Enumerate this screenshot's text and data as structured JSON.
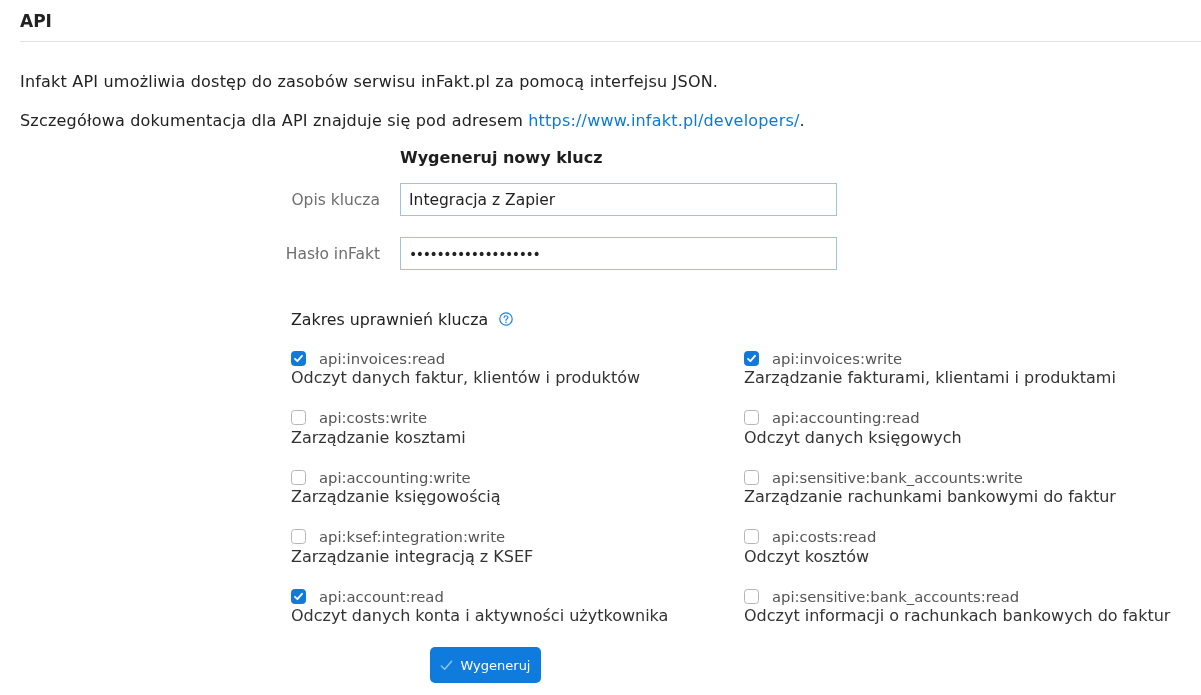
{
  "page": {
    "title": "API"
  },
  "intro": [
    {
      "text": "Infakt API umożliwia dostęp do zasobów serwisu inFakt.pl za pomocą interfejsu JSON."
    },
    {
      "text": "Szczegółowa dokumentacja dla API znajduje się pod adresem",
      "link": "https://www.infakt.pl/developers/",
      "suffix": "."
    }
  ],
  "form": {
    "title": "Wygeneruj nowy klucz",
    "fields": [
      {
        "label": "Opis klucza",
        "value": "Integracja z Zapier",
        "kind": "text"
      },
      {
        "label": "Hasło inFakt",
        "value": "•••••••••••••••••••",
        "kind": "password"
      }
    ]
  },
  "scopes": {
    "title": "Zakres uprawnień klucza",
    "items": [
      {
        "scope": "api:invoices:read",
        "description": "Odczyt danych faktur, klientów i produktów",
        "checked": true
      },
      {
        "scope": "api:invoices:write",
        "description": "Zarządzanie fakturami, klientami i produktami",
        "checked": true
      },
      {
        "scope": "api:costs:write",
        "description": "Zarządzanie kosztami",
        "checked": false
      },
      {
        "scope": "api:accounting:read",
        "description": "Odczyt danych księgowych",
        "checked": false
      },
      {
        "scope": "api:accounting:write",
        "description": "Zarządzanie księgowością",
        "checked": false
      },
      {
        "scope": "api:sensitive:bank_accounts:write",
        "description": "Zarządzanie rachunkami bankowymi do faktur",
        "checked": false
      },
      {
        "scope": "api:ksef:integration:write",
        "description": "Zarządzanie integracją z KSEF",
        "checked": false
      },
      {
        "scope": "api:costs:read",
        "description": "Odczyt kosztów",
        "checked": false
      },
      {
        "scope": "api:account:read",
        "description": "Odczyt danych konta i aktywności użytkownika",
        "checked": true
      },
      {
        "scope": "api:sensitive:bank_accounts:read",
        "description": "Odczyt informacji o rachunkach bankowych do faktur",
        "checked": false
      }
    ]
  },
  "submit": {
    "label": "Wygeneruj"
  }
}
